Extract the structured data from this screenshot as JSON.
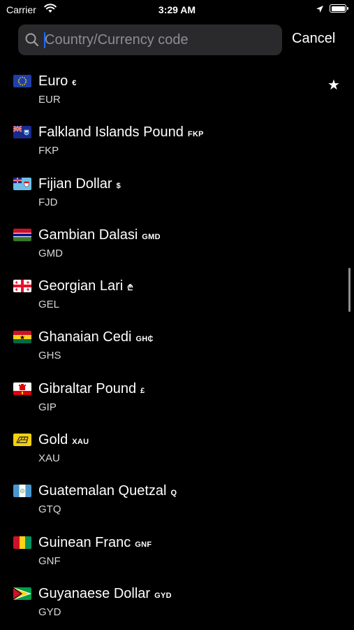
{
  "status_bar": {
    "carrier": "Carrier",
    "time": "3:29 AM"
  },
  "search": {
    "placeholder": "Country/Currency code",
    "value": ""
  },
  "cancel_label": "Cancel",
  "currencies": [
    {
      "name": "Euro",
      "symbol": "€",
      "code": "EUR",
      "flag": "eu-flag-icon",
      "favorite": true
    },
    {
      "name": "Falkland Islands Pound",
      "symbol": "FKP",
      "code": "FKP",
      "flag": "falkland-flag-icon",
      "favorite": false
    },
    {
      "name": "Fijian Dollar",
      "symbol": "$",
      "code": "FJD",
      "flag": "fiji-flag-icon",
      "favorite": false
    },
    {
      "name": "Gambian Dalasi",
      "symbol": "GMD",
      "code": "GMD",
      "flag": "gambia-flag-icon",
      "favorite": false
    },
    {
      "name": "Georgian Lari",
      "symbol": "₾",
      "code": "GEL",
      "flag": "georgia-flag-icon",
      "favorite": false
    },
    {
      "name": "Ghanaian Cedi",
      "symbol": "GH₵",
      "code": "GHS",
      "flag": "ghana-flag-icon",
      "favorite": false
    },
    {
      "name": "Gibraltar Pound",
      "symbol": "£",
      "code": "GIP",
      "flag": "gibraltar-flag-icon",
      "favorite": false
    },
    {
      "name": "Gold",
      "symbol": "XAU",
      "code": "XAU",
      "flag": "gold-icon",
      "favorite": false
    },
    {
      "name": "Guatemalan Quetzal",
      "symbol": "Q",
      "code": "GTQ",
      "flag": "guatemala-flag-icon",
      "favorite": false
    },
    {
      "name": "Guinean Franc",
      "symbol": "GNF",
      "code": "GNF",
      "flag": "guinea-flag-icon",
      "favorite": false
    },
    {
      "name": "Guyanaese Dollar",
      "symbol": "GYD",
      "code": "GYD",
      "flag": "guyana-flag-icon",
      "favorite": false
    }
  ],
  "favorite_star": "★",
  "colors": {
    "background": "#000000",
    "search_field": "#2a2a2d",
    "placeholder": "#8d8d93",
    "caret": "#1e6bff"
  }
}
